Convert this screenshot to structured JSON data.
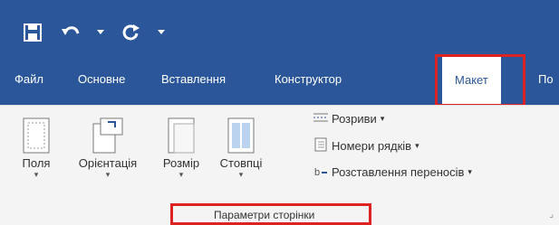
{
  "qat": {
    "save_icon": "save-icon",
    "undo_icon": "undo-icon",
    "redo_icon": "redo-icon",
    "more_icon": "customize-qat-icon"
  },
  "tabs": [
    {
      "label": "Файл"
    },
    {
      "label": "Основне"
    },
    {
      "label": "Вставлення"
    },
    {
      "label": "Конструктор"
    },
    {
      "label": "Макет",
      "active": true
    },
    {
      "label": "По"
    }
  ],
  "ribbon": {
    "buttons": [
      {
        "label": "Поля",
        "icon": "margins-icon"
      },
      {
        "label": "Орієнтація",
        "icon": "orientation-icon"
      },
      {
        "label": "Розмір",
        "icon": "size-icon"
      },
      {
        "label": "Стовпці",
        "icon": "columns-icon"
      }
    ],
    "small_items": [
      {
        "label": "Розриви",
        "icon": "breaks-icon"
      },
      {
        "label": "Номери рядків",
        "icon": "line-numbers-icon"
      },
      {
        "label": "Розставлення переносів",
        "icon": "hyphenation-icon"
      }
    ],
    "group_label": "Параметри сторінки"
  },
  "colors": {
    "accent": "#2b579a",
    "highlight": "#dd2222"
  }
}
